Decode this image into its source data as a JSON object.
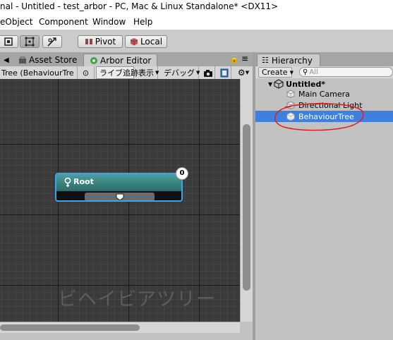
{
  "window": {
    "title": "nal - Untitled - test_arbor - PC, Mac & Linux Standalone* <DX11>"
  },
  "menu": {
    "items": [
      "eObject",
      "Component",
      "Window",
      "Help"
    ]
  },
  "toolbar": {
    "pivot_label": "Pivot",
    "global_label": "Local"
  },
  "left_tabs": {
    "asset_store": "Asset Store",
    "arbor_editor": "Arbor Editor"
  },
  "editor_toolbar": {
    "tree_label": "Tree (BehaviourTre",
    "live_tracking": "ライブ追跡",
    "display": "表示",
    "debug": "デバッグ"
  },
  "graph": {
    "root_node_title": "Root",
    "badge_count": "0",
    "watermark": "ビヘイビアツリー"
  },
  "hierarchy": {
    "tab_label": "Hierarchy",
    "create_label": "Create",
    "search_placeholder": "All",
    "scene_name": "Untitled*",
    "items": [
      "Main Camera",
      "Directional Light",
      "BehaviourTree"
    ],
    "selected_item": "BehaviourTree"
  },
  "colors": {
    "selection": "#3d80df",
    "node_border": "#3aa4ec",
    "node_header": "#3f8b88",
    "annotation": "#e02020"
  }
}
